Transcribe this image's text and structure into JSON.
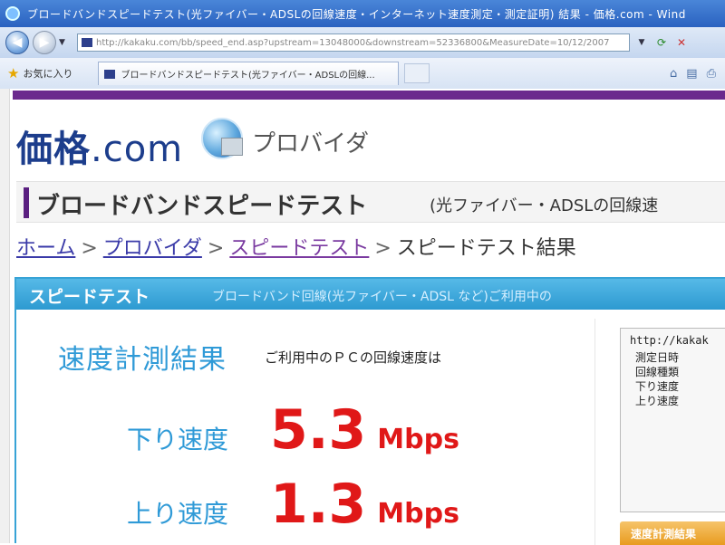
{
  "browser": {
    "window_title": "ブロードバンドスピードテスト(光ファイバー・ADSLの回線速度・インターネット速度測定・測定証明) 結果 - 価格.com - Wind",
    "address_url": "http://kakaku.com/bb/speed_end.asp?upstream=13048000&downstream=52336800&MeasureDate=10/12/2007",
    "favorites_label": "お気に入り",
    "tab_title": "ブロードバンドスピードテスト(光ファイバー・ADSLの回線..."
  },
  "site": {
    "logo_main": "価格",
    "logo_com": ".com",
    "section": "プロバイダ"
  },
  "page": {
    "heading": "ブロードバンドスピードテスト",
    "heading_sub": "(光ファイバー・ADSLの回線速",
    "breadcrumb": {
      "home": "ホーム",
      "provider": "プロバイダ",
      "speedtest": "スピードテスト",
      "current": "スピードテスト結果",
      "sep": ">"
    }
  },
  "panel": {
    "title": "スピードテスト",
    "subtitle": "ブロードバンド回線(光ファイバー・ADSL など)ご利用中の"
  },
  "result": {
    "title": "速度計測結果",
    "note": "ご利用中のＰＣの回線速度は",
    "down_label": "下り速度",
    "down_value": "5.3",
    "up_label": "上り速度",
    "up_value": "1.3",
    "unit": "Mbps"
  },
  "info": {
    "url": "http://kakak",
    "rows": [
      "測定日時",
      "回線種類",
      "下り速度",
      "上り速度"
    ]
  },
  "orange_button_label": "速度計測結果"
}
